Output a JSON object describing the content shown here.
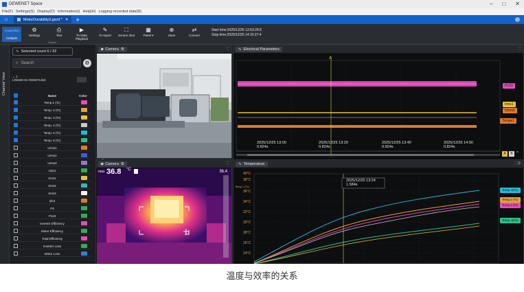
{
  "window": {
    "title": "DEWENET Space",
    "controls": [
      "–",
      "□",
      "✕"
    ]
  },
  "menu": [
    "File(F)",
    "Settings(S)",
    "Display(D)",
    "Information(I)",
    "Help(H)",
    "Logging recorded data(R)"
  ],
  "tabs": {
    "active": "MotorDurability3.gxcd *",
    "close": "✕",
    "add": "+"
  },
  "ribbon": {
    "mode_top": "Acquisition",
    "mode_bottom": "Analysis",
    "buttons": [
      {
        "icon": "⚙",
        "label": "Settings"
      },
      {
        "icon": "⎙",
        "label": "Text"
      },
      {
        "icon": "▶",
        "label": "To Data Playback"
      },
      {
        "icon": "✎",
        "label": "To report"
      },
      {
        "icon": "⛶",
        "label": "Screen shot"
      },
      {
        "icon": "▦",
        "label": "Panel ▾"
      },
      {
        "icon": "⊕",
        "label": "Save"
      },
      {
        "icon": "⇄",
        "label": "Convert"
      }
    ],
    "group_label": "Output",
    "start_time": "Start time:2025/12/25 12:53:29.8",
    "stop_time": "Stop time:2025/12/25 14:10:27.4"
  },
  "sidebar": {
    "vertical_tab": "Channel View",
    "selected_count": "Selected count 6 / 32",
    "search_placeholder": "Search",
    "device_id": "1",
    "device_name": "LR8450-01 #200271353",
    "header_name": "Name",
    "header_color": "Color",
    "channels": [
      {
        "name": "Temp.1 (Tc)",
        "checked": true,
        "color": "#e94bbd"
      },
      {
        "name": "Temp. 2 (Tc)",
        "checked": true,
        "color": "#e6a23a"
      },
      {
        "name": "Temp. 3 (Tc)",
        "checked": true,
        "color": "#e8c13d"
      },
      {
        "name": "Temp. 4 (Tc)",
        "checked": true,
        "color": "#c9c9c9"
      },
      {
        "name": "Temp. 5 (Tc)",
        "checked": true,
        "color": "#27b9d6"
      },
      {
        "name": "Temp. 6 (Tc)",
        "checked": true,
        "color": "#2cc08a"
      },
      {
        "name": "Urms1",
        "checked": false,
        "color": "#e07a2e"
      },
      {
        "name": "Urms2",
        "checked": false,
        "color": "#3a5fcf"
      },
      {
        "name": "Urms3",
        "checked": false,
        "color": "#9a73d6"
      },
      {
        "name": "Udc4",
        "checked": false,
        "color": "#2fae55"
      },
      {
        "name": "Irms1",
        "checked": false,
        "color": "#e6c23a"
      },
      {
        "name": "Irms2",
        "checked": false,
        "color": "#3ab3b3"
      },
      {
        "name": "Irms3",
        "checked": false,
        "color": "#f2f2f2"
      },
      {
        "name": "Idc4",
        "checked": false,
        "color": "#e07a2e"
      },
      {
        "name": "P4",
        "checked": false,
        "color": "#2fae55"
      },
      {
        "name": "P123",
        "checked": false,
        "color": "#2fae55"
      },
      {
        "name": "Inverter Efficiency",
        "checked": false,
        "color": "#e94bbd"
      },
      {
        "name": "Motor Efficiency",
        "checked": false,
        "color": "#2fae55"
      },
      {
        "name": "Total Efficiency",
        "checked": false,
        "color": "#e94bbd"
      },
      {
        "name": "Inverter Loss",
        "checked": false,
        "color": "#2fae55"
      },
      {
        "name": "Motor Loss",
        "checked": false,
        "color": "#3a7be0"
      }
    ]
  },
  "camera_panel": {
    "title": "Camera"
  },
  "thermal_panel": {
    "title": "Camera",
    "max_label": "max",
    "max_value": "36.8",
    "unit": "°C",
    "scale_value": "36.4"
  },
  "electrical_panel": {
    "title": "Electrical Parameters",
    "cursor_label": "A",
    "time_labels": [
      {
        "date": "2025/12/25 13:00",
        "sub": "0.824s"
      },
      {
        "date": "2025/12/25 13:20",
        "sub": "0.824s"
      },
      {
        "date": "2025/12/25 13:40",
        "sub": "0.824s"
      },
      {
        "date": "2025/12/25 14:00",
        "sub": "0.824s"
      }
    ],
    "tags": [
      "P123",
      "Irms1",
      "Urms1",
      "Torque1"
    ],
    "tag_colors": [
      "#e94bbd",
      "#e6c23a",
      "#e07a2e",
      "#e07a2e"
    ],
    "ab_buttons": [
      "A",
      "B"
    ]
  },
  "temperature_panel": {
    "title": "Temperature",
    "cursor_time": "2025/12/25 13:24",
    "cursor_sub": "1.584s",
    "axis_top": "40°C",
    "axis_labels": [
      "38°C",
      "36°C",
      "34°C",
      "32°C",
      "30°C",
      "28°C",
      "26°C",
      "24°C"
    ],
    "axis_channel": "Temp.1 (Tc)",
    "tags": [
      "Temp. 5(Tc)",
      "Temp.2 (Tc)",
      "Temp.1 (Tc)",
      "Temp. 6(Tc)"
    ],
    "tag_colors": [
      "#27b9d6",
      "#e6a23a",
      "#e94bbd",
      "#2cc08a"
    ]
  },
  "caption": "温度与效率的关系"
}
